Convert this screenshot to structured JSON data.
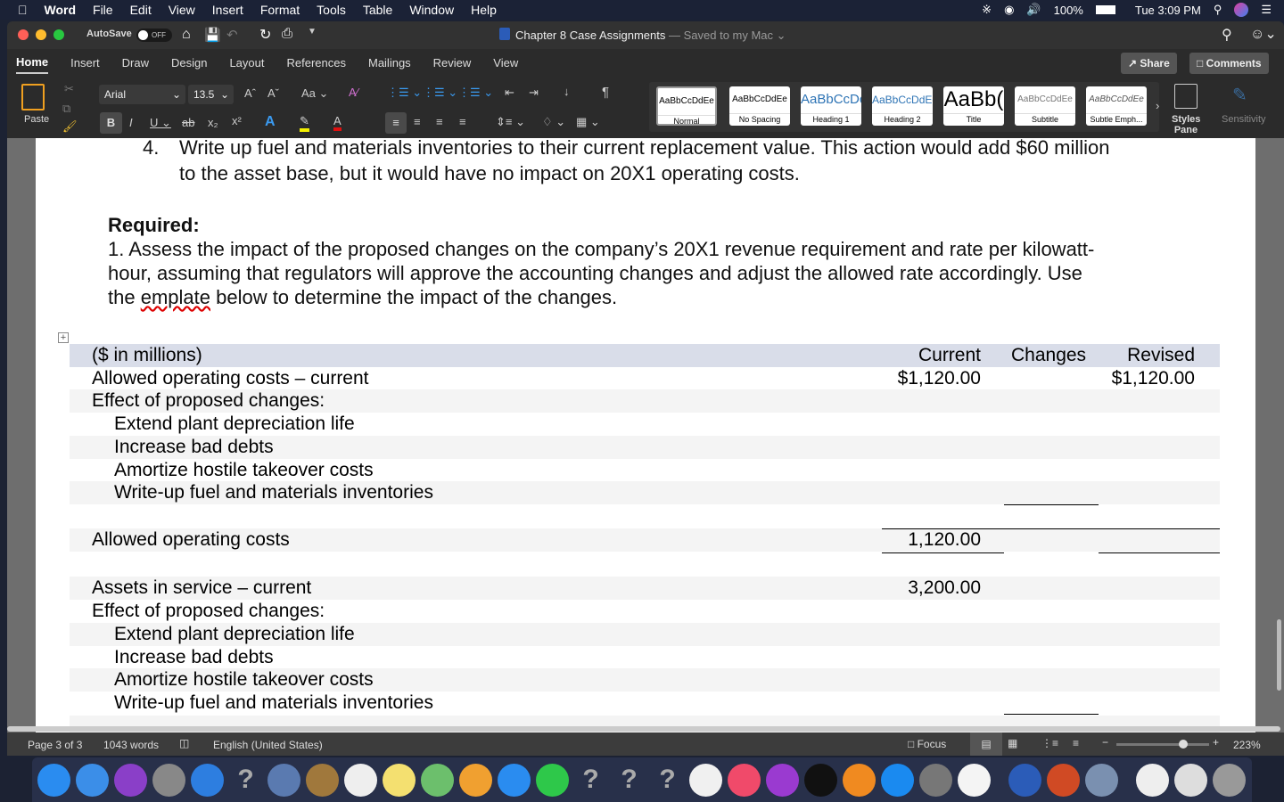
{
  "menubar": {
    "app": "Word",
    "items": [
      "File",
      "Edit",
      "View",
      "Insert",
      "Format",
      "Tools",
      "Table",
      "Window",
      "Help"
    ],
    "battery": "100%",
    "clock": "Tue 3:09 PM"
  },
  "titlebar": {
    "autosave": "AutoSave",
    "autosave_state": "OFF",
    "doc_title": "Chapter 8 Case Assignments",
    "saved": "— Saved to my Mac"
  },
  "tabs": [
    "Home",
    "Insert",
    "Draw",
    "Design",
    "Layout",
    "References",
    "Mailings",
    "Review",
    "View"
  ],
  "active_tab": "Home",
  "share": "Share",
  "comments": "Comments",
  "ribbon": {
    "paste": "Paste",
    "font": "Arial",
    "size": "13.5",
    "styles": [
      {
        "preview": "AaBbCcDdEe",
        "label": "Normal"
      },
      {
        "preview": "AaBbCcDdEe",
        "label": "No Spacing"
      },
      {
        "preview": "AaBbCcDc",
        "label": "Heading 1"
      },
      {
        "preview": "AaBbCcDdEe",
        "label": "Heading 2"
      },
      {
        "preview": "AaBb(",
        "label": "Title"
      },
      {
        "preview": "AaBbCcDdEe",
        "label": "Subtitle"
      },
      {
        "preview": "AaBbCcDdEe",
        "label": "Subtle Emph..."
      }
    ],
    "styles_pane": "Styles Pane",
    "sensitivity": "Sensitivity"
  },
  "doc": {
    "item4_num": "4.",
    "item4_line1": "Write up fuel and materials inventories to their current replacement value. This action would add $60 million",
    "item4_line2": "to the asset base, but it would have no impact on 20X1 operating costs.",
    "required": "Required:",
    "req_line1": "1. Assess the impact of the proposed changes on the company’s 20X1 revenue requirement and rate per kilowatt-",
    "req_line2": "hour, assuming that regulators will approve the accounting changes and adjust the allowed rate accordingly.  Use",
    "req_line3a": "the ",
    "req_line3b": "emplate",
    "req_line3c": " below to determine the impact of the changes.",
    "table": {
      "headers": [
        "($ in millions)",
        "Current",
        "Changes",
        "Revised"
      ],
      "rows": [
        {
          "label": "Allowed operating costs – current",
          "current": "$1,120.00",
          "changes": "",
          "revised": "$1,120.00",
          "indent": 0
        },
        {
          "label": "Effect of proposed changes:",
          "current": "",
          "changes": "",
          "revised": "",
          "indent": 0
        },
        {
          "label": "Extend plant depreciation life",
          "current": "",
          "changes": "",
          "revised": "",
          "indent": 1
        },
        {
          "label": "Increase bad debts",
          "current": "",
          "changes": "",
          "revised": "",
          "indent": 1
        },
        {
          "label": "Amortize hostile takeover costs",
          "current": "",
          "changes": "",
          "revised": "",
          "indent": 1
        },
        {
          "label": "Write-up fuel and materials inventories",
          "current": "",
          "changes": "",
          "revised": "",
          "indent": 1
        },
        {
          "label": "",
          "current": "",
          "changes": "",
          "revised": "",
          "indent": 0
        },
        {
          "label": "Allowed operating costs",
          "current": "1,120.00",
          "changes": "",
          "revised": "",
          "indent": 0
        },
        {
          "label": "",
          "current": "",
          "changes": "",
          "revised": "",
          "indent": 0
        },
        {
          "label": "Assets in service – current",
          "current": "3,200.00",
          "changes": "",
          "revised": "",
          "indent": 0
        },
        {
          "label": "Effect of proposed changes:",
          "current": "",
          "changes": "",
          "revised": "",
          "indent": 0
        },
        {
          "label": "Extend plant depreciation life",
          "current": "",
          "changes": "",
          "revised": "",
          "indent": 1
        },
        {
          "label": "Increase bad debts",
          "current": "",
          "changes": "",
          "revised": "",
          "indent": 1
        },
        {
          "label": "Amortize hostile takeover costs",
          "current": "",
          "changes": "",
          "revised": "",
          "indent": 1
        },
        {
          "label": "Write-up fuel and materials inventories",
          "current": "",
          "changes": "",
          "revised": "",
          "indent": 1
        }
      ]
    }
  },
  "status": {
    "page": "Page 3 of 3",
    "words": "1043 words",
    "language": "English (United States)",
    "focus": "Focus",
    "zoom": "223%",
    "zoom_level": 0.75
  },
  "dock": [
    {
      "name": "messages-icon",
      "color": "#2a8cf0"
    },
    {
      "name": "finder-icon",
      "color": "#3b8ee8"
    },
    {
      "name": "siri-icon",
      "color": "#8a3fc8"
    },
    {
      "name": "launchpad-icon",
      "color": "#888"
    },
    {
      "name": "safari-icon",
      "color": "#2d7ee0"
    },
    {
      "name": "unknown-app-icon",
      "color": "transparent"
    },
    {
      "name": "preview-icon",
      "color": "#5a7ab0"
    },
    {
      "name": "contacts-icon",
      "color": "#a0783c"
    },
    {
      "name": "calendar-icon",
      "color": "#eee"
    },
    {
      "name": "notes-icon",
      "color": "#f4e070"
    },
    {
      "name": "maps-icon",
      "color": "#6cbf6c"
    },
    {
      "name": "photos-icon",
      "color": "#f0a030"
    },
    {
      "name": "messages-icon",
      "color": "#2a8cf0"
    },
    {
      "name": "facetime-icon",
      "color": "#2ec84a"
    },
    {
      "name": "unknown-app-icon",
      "color": "transparent"
    },
    {
      "name": "unknown-app-icon",
      "color": "transparent"
    },
    {
      "name": "unknown-app-icon",
      "color": "transparent"
    },
    {
      "name": "news-icon",
      "color": "#f0f0f0"
    },
    {
      "name": "music-icon",
      "color": "#f04a6a"
    },
    {
      "name": "podcasts-icon",
      "color": "#9a3ad0"
    },
    {
      "name": "tv-icon",
      "color": "#111"
    },
    {
      "name": "books-icon",
      "color": "#f08a20"
    },
    {
      "name": "app-store-icon",
      "color": "#1a8af0"
    },
    {
      "name": "system-preferences-icon",
      "color": "#777"
    },
    {
      "name": "reminders-icon",
      "color": "#f4f4f4"
    },
    {
      "name": "word-icon",
      "color": "#2b5cb8"
    },
    {
      "name": "powerpoint-icon",
      "color": "#d04a24"
    },
    {
      "name": "image-capture-icon",
      "color": "#7a90b0"
    },
    {
      "name": "document-icon",
      "color": "#eee"
    },
    {
      "name": "screenshot-icon",
      "color": "#ddd"
    },
    {
      "name": "trash-icon",
      "color": "#999"
    }
  ]
}
